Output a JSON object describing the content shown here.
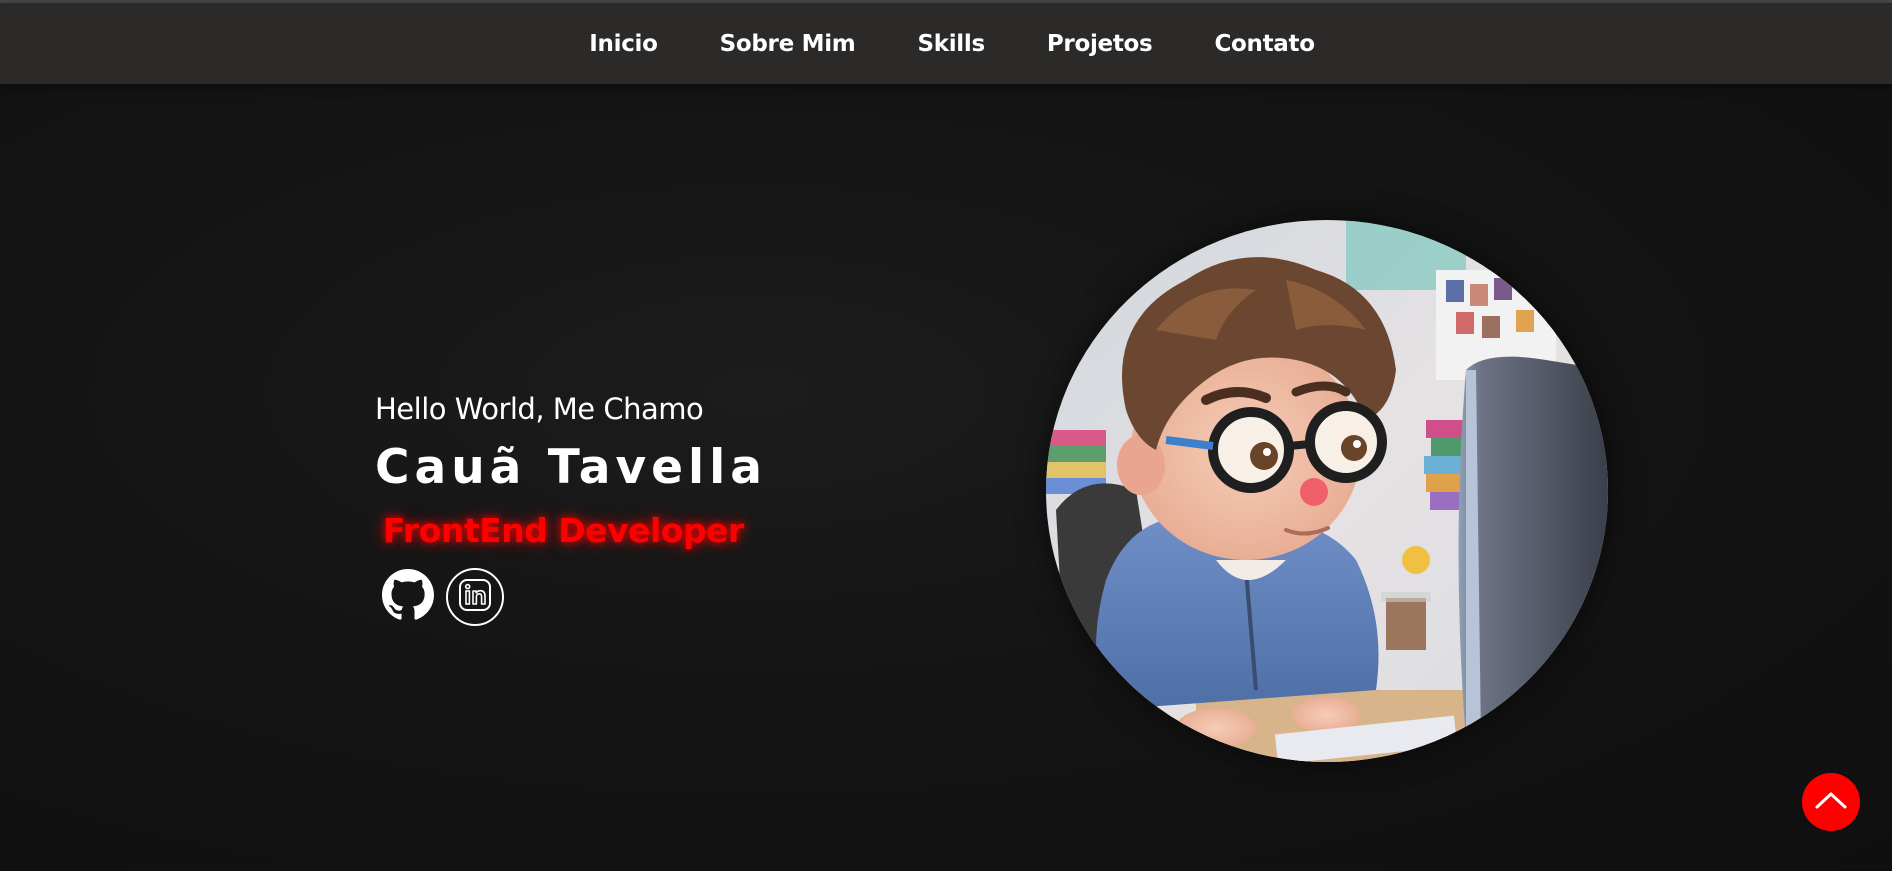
{
  "nav": {
    "items": [
      {
        "label": "Inicio"
      },
      {
        "label": "Sobre Mim"
      },
      {
        "label": "Skills"
      },
      {
        "label": "Projetos"
      },
      {
        "label": "Contato"
      }
    ]
  },
  "hero": {
    "greeting": "Hello World, Me Chamo",
    "name": "Cauã Tavella",
    "role": "FrontEnd Developer"
  },
  "socials": [
    {
      "icon": "github-icon"
    },
    {
      "icon": "linkedin-icon"
    }
  ],
  "avatar": {
    "icon": "avatar-illustration"
  },
  "scroll_top": {
    "icon": "chevron-up-icon"
  },
  "colors": {
    "accent": "#ff0000",
    "navbar_bg": "#2b2a29",
    "page_bg": "#131313",
    "text": "#ffffff"
  }
}
